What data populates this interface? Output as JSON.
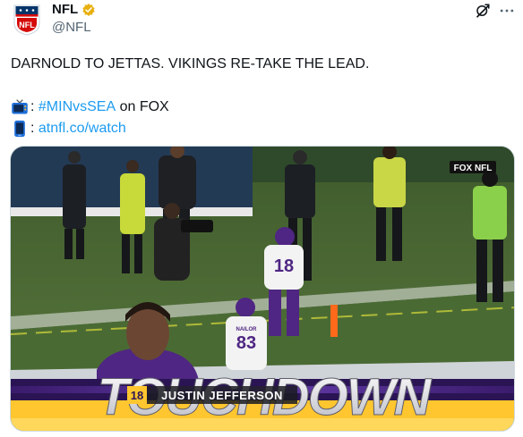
{
  "author": {
    "display_name": "NFL",
    "handle": "@NFL",
    "avatar_text": "NFL"
  },
  "tweet": {
    "headline": "DARNOLD TO JETTAS. VIKINGS RE-TAKE THE LEAD.",
    "line1_sep": ": ",
    "line1_hashtag": "#MINvsSEA",
    "line1_suffix": " on FOX",
    "line2_sep": ": ",
    "line2_link": "atnfl.co/watch"
  },
  "media": {
    "network_logo": "FOX NFL",
    "banner_text": "TOUCHDOWN",
    "player_number": "18",
    "player_name": "JUSTIN JEFFERSON",
    "jersey_number_a": "18",
    "jersey_number_b": "83",
    "jersey_name_b": "NAILOR"
  },
  "colors": {
    "link": "#1d9bf0",
    "verified": "#e8b00f",
    "vikings_purple": "#4f2683",
    "vikings_gold": "#ffc62f",
    "field_green": "#4f6a36"
  },
  "icons": {
    "verified": "verified-badge-icon",
    "grok": "grok-icon",
    "more": "more-options-icon",
    "tv": "tv-emoji-icon",
    "phone": "phone-emoji-icon"
  }
}
